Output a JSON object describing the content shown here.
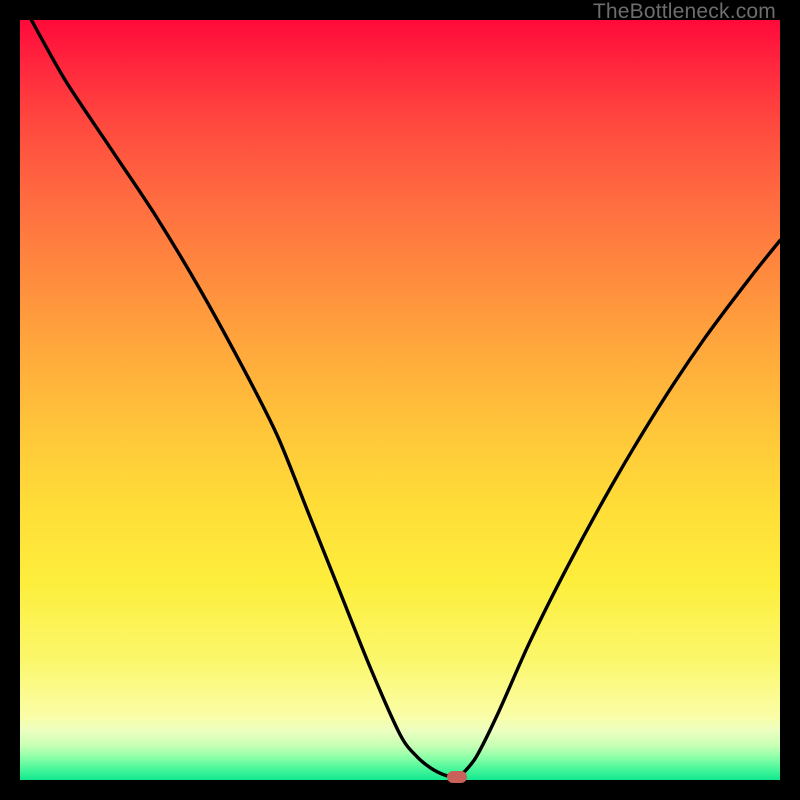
{
  "watermark": "TheBottleneck.com",
  "colors": {
    "frame": "#000000",
    "marker": "#c9605a",
    "curve": "#000000"
  },
  "chart_data": {
    "type": "line",
    "title": "",
    "xlabel": "",
    "ylabel": "",
    "xlim": [
      0,
      100
    ],
    "ylim": [
      0,
      100
    ],
    "grid": false,
    "legend": false,
    "gradient_stops": [
      {
        "pos": 0,
        "color": "#ff0a3a"
      },
      {
        "pos": 0.5,
        "color": "#ffc63a"
      },
      {
        "pos": 0.84,
        "color": "#fbf76a"
      },
      {
        "pos": 0.93,
        "color": "#ecffc0"
      },
      {
        "pos": 1.0,
        "color": "#11e88f"
      }
    ],
    "series": [
      {
        "name": "bottleneck-curve",
        "x": [
          1.5,
          6,
          12,
          18,
          24,
          30,
          34,
          38,
          42,
          46,
          50,
          52,
          54,
          56,
          57.5,
          58,
          60,
          63,
          67,
          72,
          78,
          84,
          90,
          96,
          100
        ],
        "values": [
          100,
          92,
          83,
          74,
          64,
          53,
          45,
          35,
          25,
          15,
          6,
          3.3,
          1.6,
          0.6,
          0.4,
          0.6,
          3,
          9,
          18,
          28,
          39,
          49,
          58,
          66,
          71
        ]
      }
    ],
    "marker": {
      "x": 57.5,
      "y": 0.4,
      "shape": "rounded-rect"
    }
  }
}
